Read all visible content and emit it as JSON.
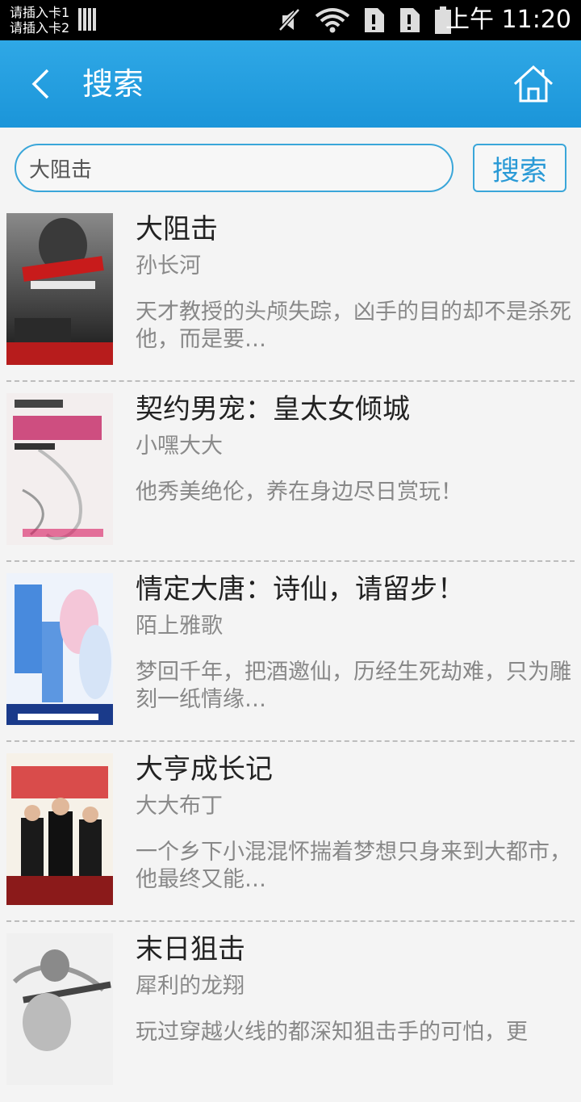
{
  "status_bar": {
    "sim1": "请插入卡1",
    "sim2": "请插入卡2",
    "time": "上午 11:20",
    "icons": [
      "mute-icon",
      "wifi-icon",
      "sim1-icon",
      "sim2-icon",
      "battery-icon"
    ]
  },
  "header": {
    "title": "搜索",
    "back_icon": "back-chevron-icon",
    "home_icon": "home-icon"
  },
  "search": {
    "query": "大阻击",
    "button_label": "搜索"
  },
  "results": [
    {
      "title": "大阻击",
      "author": "孙长河",
      "description": "天才教授的头颅失踪，凶手的目的却不是杀死他，而是要…"
    },
    {
      "title": "契约男宠：皇太女倾城",
      "author": "小嘿大大",
      "description": "他秀美绝伦，养在身边尽日赏玩！"
    },
    {
      "title": "情定大唐：诗仙，请留步！",
      "author": "陌上雅歌",
      "description": "梦回千年，把酒邀仙，历经生死劫难，只为雕刻一纸情缘…"
    },
    {
      "title": "大亨成长记",
      "author": "大大布丁",
      "description": "一个乡下小混混怀揣着梦想只身来到大都市，他最终又能…"
    },
    {
      "title": "末日狙击",
      "author": "犀利的龙翔",
      "description": "玩过穿越火线的都深知狙击手的可怕，更"
    }
  ],
  "colors": {
    "accent": "#1b95d9",
    "input_border": "#3aa6d9"
  }
}
